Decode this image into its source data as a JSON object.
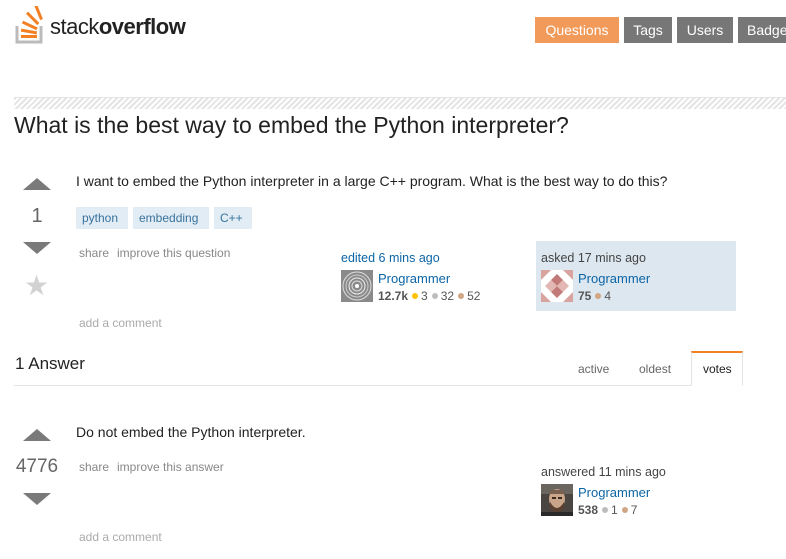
{
  "header": {
    "logo_light": "stack",
    "logo_bold": "overflow",
    "nav": [
      "Questions",
      "Tags",
      "Users",
      "Badge"
    ]
  },
  "question": {
    "title": "What is the best way to embed the Python interpreter?",
    "votes": "1",
    "body": "I want to embed the Python interpreter in a large C++ program. What is the best way to do this?",
    "tags": [
      "python",
      "embedding",
      "C++"
    ],
    "menu_share": "share",
    "menu_improve": "improve this question",
    "edited": "edited 6 mins ago",
    "editor": {
      "name": "Programmer",
      "rep": "12.7k",
      "gold": "3",
      "silver": "32",
      "bronze": "52"
    },
    "asked": "asked 17 mins ago",
    "owner": {
      "name": "Programmer",
      "rep": "75",
      "bronze": "4"
    },
    "add_comment": "add a comment"
  },
  "answers": {
    "count_label": "1 Answer",
    "tabs": [
      "active",
      "oldest",
      "votes"
    ],
    "active_tab": "votes"
  },
  "answer": {
    "votes": "4776",
    "body": "Do not embed the Python interpreter.",
    "menu_share": "share",
    "menu_improve": "improve this answer",
    "answered": "answered 11 mins ago",
    "owner": {
      "name": "Programmer",
      "rep": "538",
      "silver": "1",
      "bronze": "7"
    },
    "add_comment": "add a comment"
  },
  "colors": {
    "accent": "#f48024",
    "nav_active": "#f19a5a",
    "nav": "#777777",
    "link": "#0c65a5",
    "tag_bg": "#e1ecf4",
    "tag_text": "#39739d",
    "owner_bg": "#dde7f0"
  }
}
